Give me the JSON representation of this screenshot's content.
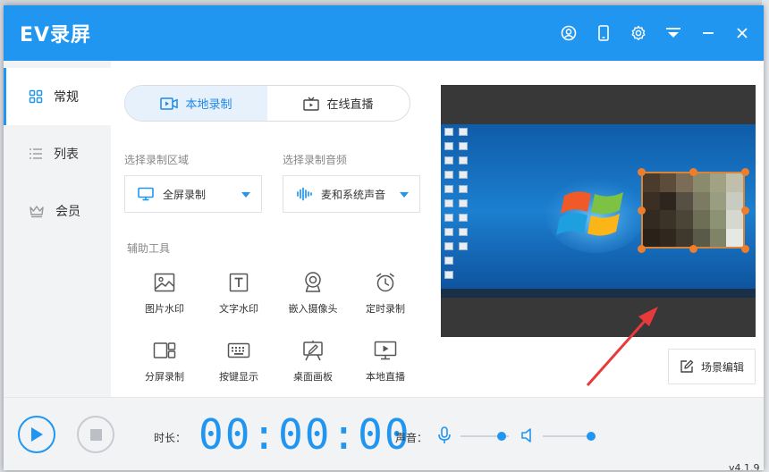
{
  "app": {
    "title": "EV录屏",
    "version": "v4.1.9"
  },
  "sidebar": {
    "items": [
      {
        "label": "常规",
        "icon": "grid-icon"
      },
      {
        "label": "列表",
        "icon": "list-icon"
      },
      {
        "label": "会员",
        "icon": "crown-icon"
      }
    ]
  },
  "tabs": [
    {
      "label": "本地录制",
      "icon": "record-icon"
    },
    {
      "label": "在线直播",
      "icon": "tv-icon"
    }
  ],
  "area": {
    "label": "选择录制区域",
    "value": "全屏录制"
  },
  "audio": {
    "label": "选择录制音频",
    "value": "麦和系统声音"
  },
  "tools": {
    "label": "辅助工具",
    "items": [
      {
        "label": "图片水印"
      },
      {
        "label": "文字水印"
      },
      {
        "label": "嵌入摄像头"
      },
      {
        "label": "定时录制"
      },
      {
        "label": "分屏录制"
      },
      {
        "label": "按键显示"
      },
      {
        "label": "桌面画板"
      },
      {
        "label": "本地直播"
      }
    ]
  },
  "scene_edit": "场景编辑",
  "bottom": {
    "duration_label": "时长：",
    "timer": "00:00:00",
    "volume_label": "声音：",
    "mic_level": 0.85,
    "speaker_level": 1.0
  },
  "colors": {
    "accent": "#2196f0",
    "handle": "#ee7d2c"
  }
}
